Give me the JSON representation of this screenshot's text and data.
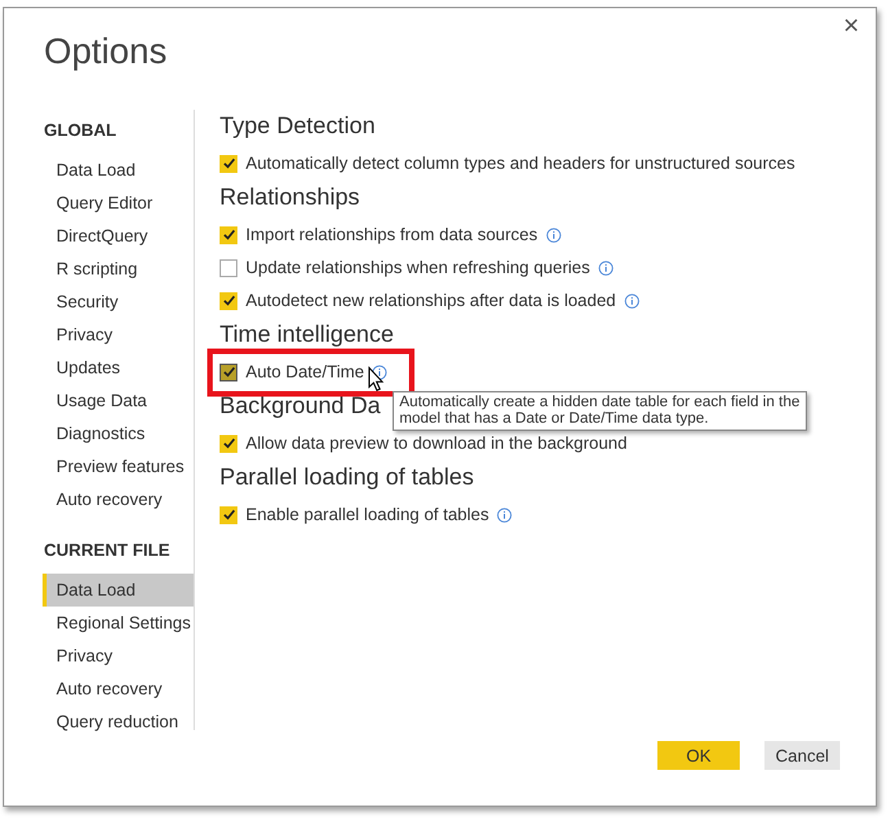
{
  "window": {
    "title": "Options",
    "close": "×"
  },
  "sidebar": [
    {
      "heading": "GLOBAL",
      "items": [
        {
          "label": "Data Load",
          "selected": false
        },
        {
          "label": "Query Editor",
          "selected": false
        },
        {
          "label": "DirectQuery",
          "selected": false
        },
        {
          "label": "R scripting",
          "selected": false
        },
        {
          "label": "Security",
          "selected": false
        },
        {
          "label": "Privacy",
          "selected": false
        },
        {
          "label": "Updates",
          "selected": false
        },
        {
          "label": "Usage Data",
          "selected": false
        },
        {
          "label": "Diagnostics",
          "selected": false
        },
        {
          "label": "Preview features",
          "selected": false
        },
        {
          "label": "Auto recovery",
          "selected": false
        }
      ]
    },
    {
      "heading": "CURRENT FILE",
      "items": [
        {
          "label": "Data Load",
          "selected": true
        },
        {
          "label": "Regional Settings",
          "selected": false
        },
        {
          "label": "Privacy",
          "selected": false
        },
        {
          "label": "Auto recovery",
          "selected": false
        },
        {
          "label": "Query reduction",
          "selected": false
        }
      ]
    }
  ],
  "sections": [
    {
      "heading": "Type Detection",
      "options": [
        {
          "label": "Automatically detect column types and headers for unstructured sources",
          "checked": true,
          "info": false,
          "highlighted": false
        }
      ]
    },
    {
      "heading": "Relationships",
      "options": [
        {
          "label": "Import relationships from data sources",
          "checked": true,
          "info": true,
          "highlighted": false
        },
        {
          "label": "Update relationships when refreshing queries",
          "checked": false,
          "info": true,
          "highlighted": false
        },
        {
          "label": "Autodetect new relationships after data is loaded",
          "checked": true,
          "info": true,
          "highlighted": false
        }
      ]
    },
    {
      "heading": "Time intelligence",
      "options": [
        {
          "label": "Auto Date/Time",
          "checked": true,
          "info": true,
          "highlighted": true,
          "tooltip": "Automatically create a hidden date table for each field in the model that has a Date or Date/Time data type."
        }
      ]
    },
    {
      "heading": "Background Da",
      "options": [
        {
          "label": "Allow data preview to download in the background",
          "checked": true,
          "info": false,
          "highlighted": false
        }
      ]
    },
    {
      "heading": "Parallel loading of tables",
      "options": [
        {
          "label": "Enable parallel loading of tables",
          "checked": true,
          "info": true,
          "highlighted": false
        }
      ]
    }
  ],
  "buttons": [
    {
      "label": "OK",
      "kind": "primary"
    },
    {
      "label": "Cancel",
      "kind": "secondary"
    }
  ]
}
